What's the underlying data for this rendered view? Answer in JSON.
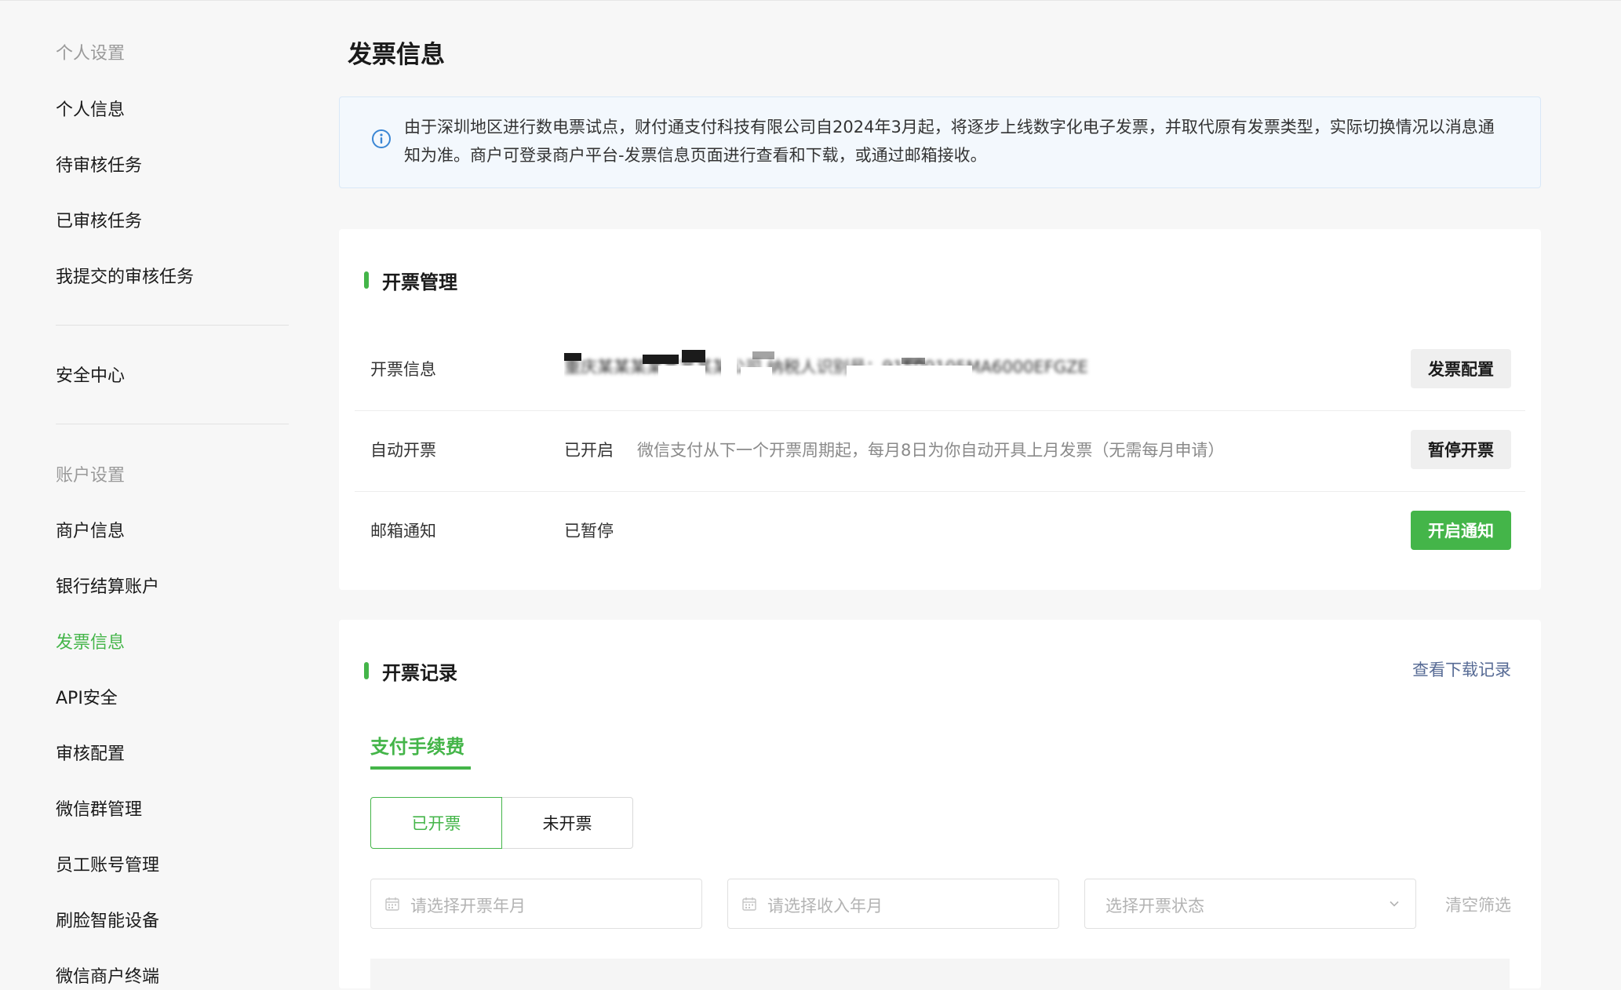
{
  "sidebar": {
    "groups": [
      {
        "title": "个人设置",
        "items": [
          "个人信息",
          "待审核任务",
          "已审核任务",
          "我提交的审核任务"
        ]
      },
      {
        "title": "",
        "items": [
          "安全中心"
        ]
      },
      {
        "title": "账户设置",
        "items": [
          "商户信息",
          "银行结算账户",
          "发票信息",
          "API安全",
          "审核配置",
          "微信群管理",
          "员工账号管理",
          "刷脸智能设备",
          "微信商户终端"
        ]
      }
    ],
    "active_item": "发票信息",
    "colors": {
      "active": "#44b549"
    }
  },
  "page": {
    "title": "发票信息"
  },
  "notice": {
    "icon": "info-icon",
    "text": "由于深圳地区进行数电票试点，财付通支付科技有限公司自2024年3月起，将逐步上线数字化电子发票，并取代原有发票类型，实际切换情况以消息通知为准。商户可登录商户平台-发票信息页面进行查看和下载，或通过邮箱接收。"
  },
  "invoice_management": {
    "title": "开票管理",
    "rows": [
      {
        "label": "开票信息",
        "value": "重庆某某某某某某某某公司  纳税人识别号：91500105MA6000EFGZE",
        "button": "发票配置"
      },
      {
        "label": "自动开票",
        "value": "已开启",
        "desc": "微信支付从下一个开票周期起，每月8日为你自动开具上月发票（无需每月申请）",
        "button": "暂停开票"
      },
      {
        "label": "邮箱通知",
        "value": "已暂停",
        "button": "开启通知"
      }
    ]
  },
  "invoice_records": {
    "title": "开票记录",
    "link": "查看下载记录",
    "tab": "支付手续费",
    "segments": [
      "已开票",
      "未开票"
    ],
    "filters": {
      "month_placeholder": "请选择开票年月",
      "income_placeholder": "请选择收入年月",
      "status_placeholder": "选择开票状态",
      "clear": "清空筛选"
    }
  },
  "colors": {
    "accent": "#44b549",
    "link": "#576b95",
    "notice_bg": "#f3f8fd"
  }
}
